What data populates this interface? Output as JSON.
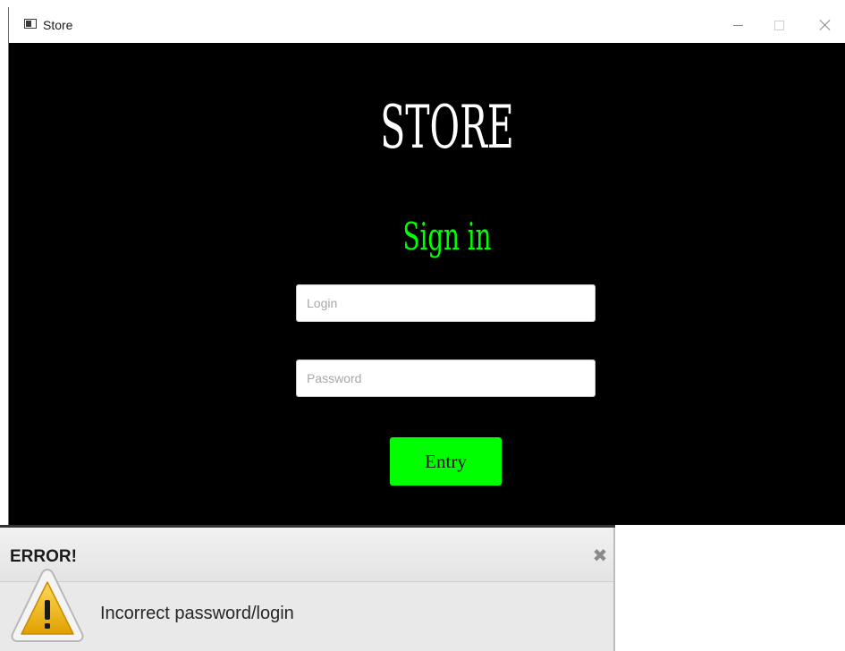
{
  "window": {
    "title": "Store",
    "app_icon": "window-app-icon"
  },
  "login_screen": {
    "heading": "STORE",
    "subheading": "Sign in",
    "login_placeholder": "Login",
    "password_placeholder": "Password",
    "entry_button": "Entry"
  },
  "error_dialog": {
    "title": "ERROR!",
    "message": "Incorrect password/login",
    "close_glyph": "✖",
    "icon": "warning-icon"
  },
  "colors": {
    "background": "#000000",
    "heading": "#ffffff",
    "accent_green": "#00ff00"
  }
}
